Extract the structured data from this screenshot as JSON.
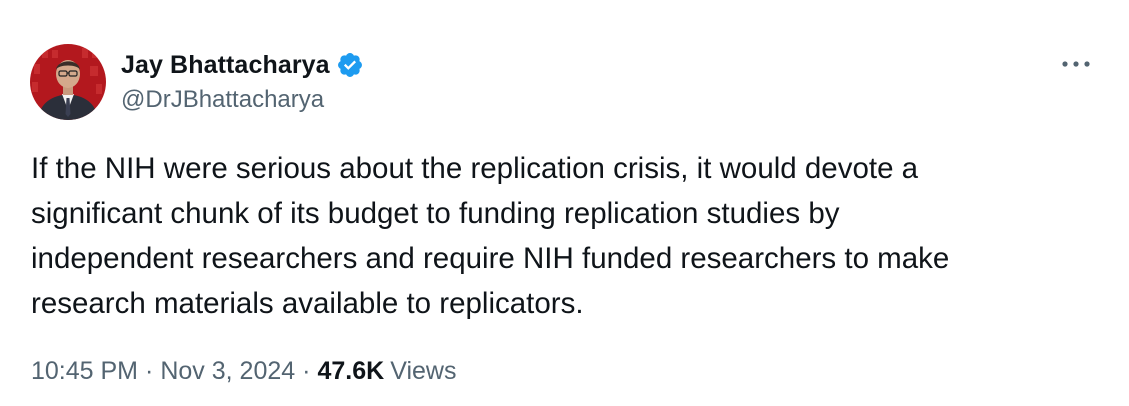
{
  "author": {
    "name": "Jay Bhattacharya",
    "handle": "@DrJBhattacharya",
    "verified": true,
    "verified_icon": "verified-badge-icon",
    "verified_color": "#1d9bf0"
  },
  "tweet": {
    "lines": [
      "If the NIH were serious about the replication crisis, it would devote a",
      "significant chunk of its budget to funding replication studies by",
      "independent researchers and require NIH funded researchers to make",
      "research materials available to replicators."
    ]
  },
  "meta": {
    "time": "10:45 PM",
    "separator": "·",
    "date": "Nov 3, 2024",
    "views_count": "47.6K",
    "views_label": "Views"
  },
  "menu": {
    "icon": "more-options-icon"
  },
  "colors": {
    "text_primary": "#0f1419",
    "text_secondary": "#536471",
    "accent": "#1d9bf0",
    "background": "#ffffff"
  }
}
